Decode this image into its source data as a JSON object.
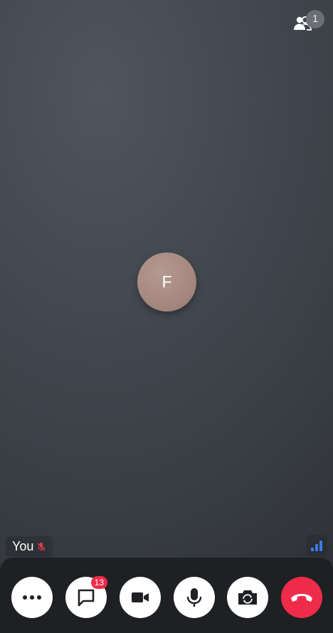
{
  "header": {
    "participants_icon": "participants-icon",
    "participant_count": "1"
  },
  "stage": {
    "avatar_initial": "F",
    "avatar_color": "#a88b83",
    "self_label": "You",
    "self_mic_icon": "mic-muted-icon",
    "signal_icon": "signal-strength-icon",
    "signal_color": "#3d7be8"
  },
  "controls": {
    "more": {
      "icon": "more-options-icon"
    },
    "chat": {
      "icon": "chat-icon",
      "badge": "13"
    },
    "camera": {
      "icon": "video-camera-icon"
    },
    "microphone": {
      "icon": "microphone-icon"
    },
    "switch_camera": {
      "icon": "switch-camera-icon"
    },
    "end_call": {
      "icon": "end-call-icon",
      "color": "#ee2c4a"
    }
  }
}
